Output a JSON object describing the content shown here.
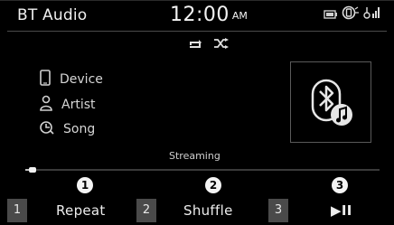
{
  "header": {
    "title": "BT Audio",
    "time": "12:00",
    "ampm": "AM",
    "icons": [
      "battery-icon",
      "phone-link-icon",
      "signal-icon"
    ]
  },
  "modes": {
    "icons": [
      "repeat-icon",
      "shuffle-icon"
    ]
  },
  "track_info": [
    {
      "icon": "phone-icon",
      "label": "Device"
    },
    {
      "icon": "person-icon",
      "label": "Artist"
    },
    {
      "icon": "song-icon",
      "label": "Song"
    }
  ],
  "album_art": {
    "icon": "bluetooth-music-icon"
  },
  "status_text": "Streaming",
  "progress": {
    "fraction": 0.02
  },
  "controls": [
    {
      "number": "1",
      "callout": "1",
      "label": "Repeat"
    },
    {
      "number": "2",
      "callout": "2",
      "label": "Shuffle"
    },
    {
      "number": "3",
      "callout": "3",
      "label": "▶II"
    }
  ],
  "colors": {
    "background": "#000000",
    "text": "#e6e6e6",
    "button": "#4a4a4a",
    "callout": "#f4f4f4"
  }
}
